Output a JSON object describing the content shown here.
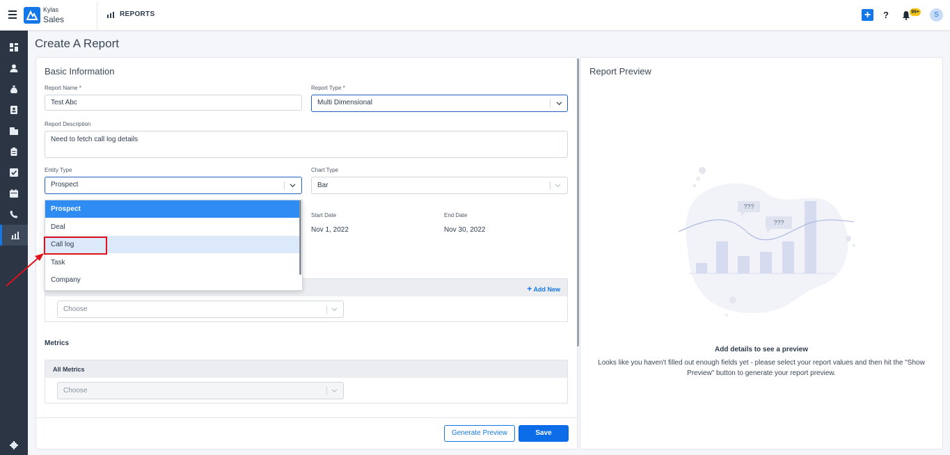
{
  "header": {
    "brand_top": "Kylas",
    "brand_bottom": "Sales",
    "section": "REPORTS",
    "notifications_badge": "99+",
    "avatar_initial": "S",
    "help": "?",
    "add": "+"
  },
  "page": {
    "title": "Create A Report"
  },
  "form": {
    "section_title": "Basic Information",
    "report_name": {
      "label": "Report Name *",
      "value": "Test Abc"
    },
    "report_type": {
      "label": "Report Type *",
      "value": "Multi Dimensional"
    },
    "report_description": {
      "label": "Report Description",
      "value": "Need to fetch call log details"
    },
    "entity_type": {
      "label": "Entity Type",
      "value": "Prospect"
    },
    "chart_type": {
      "label": "Chart Type",
      "value": "Bar"
    },
    "start_date": {
      "label": "Start Date",
      "value": "Nov 1, 2022"
    },
    "end_date": {
      "label": "End Date",
      "value": "Nov 30, 2022"
    },
    "group_by": {
      "add_new": "Add New",
      "placeholder": "Choose"
    },
    "metrics": {
      "title": "Metrics",
      "panel_label": "All Metrics",
      "placeholder": "Choose"
    }
  },
  "entity_dropdown": {
    "options": [
      "Prospect",
      "Deal",
      "Call log",
      "Task",
      "Company"
    ]
  },
  "actions": {
    "generate_preview": "Generate Preview",
    "save": "Save"
  },
  "preview": {
    "title": "Report Preview",
    "empty_title": "Add details to see a preview",
    "empty_desc": "Looks like you haven't filled out enough fields yet - please select your report values and then hit the \"Show Preview\" button to generate your report preview.",
    "bubble_1": "???",
    "bubble_2": "???"
  },
  "colors": {
    "accent": "#1477e8",
    "sidebar": "#2b3543",
    "highlight": "#e0101c"
  }
}
